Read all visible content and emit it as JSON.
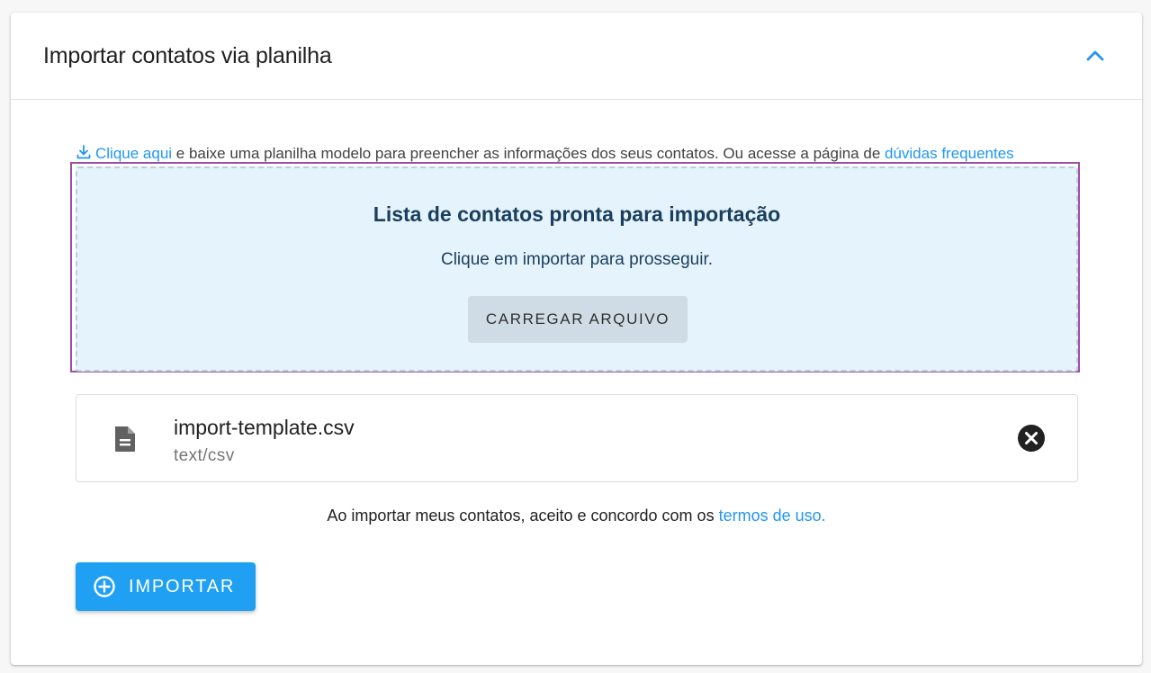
{
  "header": {
    "title": "Importar contatos via planilha"
  },
  "info": {
    "download_link": "Clique aqui",
    "text_middle": " e baixe uma planilha modelo para preencher as informações dos seus contatos. Ou acesse a página de ",
    "faq_link": "dúvidas frequentes"
  },
  "dropzone": {
    "title": "Lista de contatos pronta para importação",
    "subtitle": "Clique em importar para prosseguir.",
    "upload_label": "CARREGAR ARQUIVO"
  },
  "file": {
    "name": "import-template.csv",
    "type": "text/csv"
  },
  "terms": {
    "text": "Ao importar meus contatos, aceito e concordo com os ",
    "link": "termos de uso."
  },
  "actions": {
    "import_label": "IMPORTAR"
  },
  "colors": {
    "accent": "#2196f3",
    "primary_button": "#20a0f2",
    "dropzone_bg": "#e4f3fc",
    "highlight_outline": "#9c4ea6"
  },
  "icons": {
    "collapse": "chevron-up-icon",
    "download": "download-icon",
    "file": "file-document-icon",
    "remove": "close-circle-icon",
    "import": "plus-circle-icon"
  }
}
